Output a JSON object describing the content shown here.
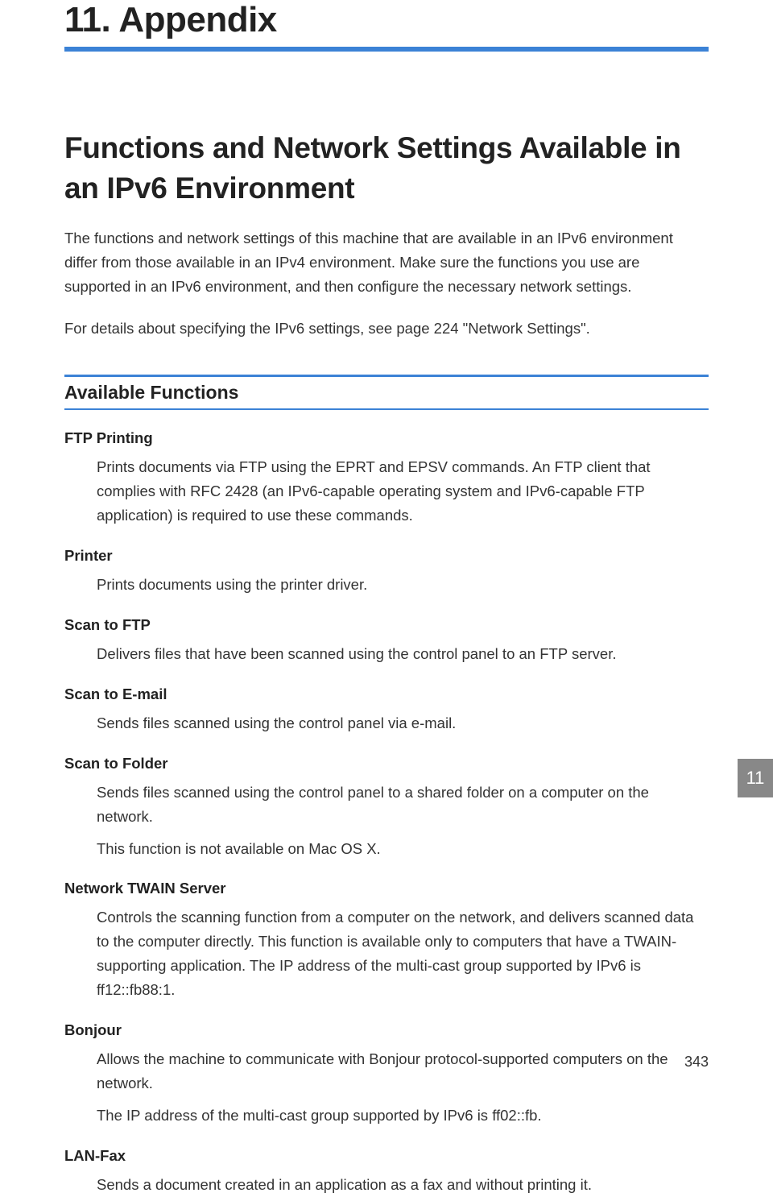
{
  "chapter": {
    "title": "11. Appendix",
    "tab": "11"
  },
  "section": {
    "title": "Functions and Network Settings Available in an IPv6 Environment",
    "intro1": "The functions and network settings of this machine that are available in an IPv6 environment differ from those available in an IPv4 environment. Make sure the functions you use are supported in an IPv6 environment, and then configure the necessary network settings.",
    "intro2": "For details about specifying the IPv6 settings, see page 224 \"Network Settings\"."
  },
  "subsection": {
    "heading": "Available Functions",
    "items": [
      {
        "title": "FTP Printing",
        "desc": [
          "Prints documents via FTP using the EPRT and EPSV commands. An FTP client that complies with RFC 2428 (an IPv6-capable operating system and IPv6-capable FTP application) is required to use these commands."
        ]
      },
      {
        "title": "Printer",
        "desc": [
          "Prints documents using the printer driver."
        ]
      },
      {
        "title": "Scan to FTP",
        "desc": [
          "Delivers files that have been scanned using the control panel to an FTP server."
        ]
      },
      {
        "title": "Scan to E-mail",
        "desc": [
          "Sends files scanned using the control panel via e-mail."
        ]
      },
      {
        "title": "Scan to Folder",
        "desc": [
          "Sends files scanned using the control panel to a shared folder on a computer on the network.",
          "This function is not available on Mac OS X."
        ]
      },
      {
        "title": "Network TWAIN Server",
        "desc": [
          "Controls the scanning function from a computer on the network, and delivers scanned data to the computer directly. This function is available only to computers that have a TWAIN-supporting application. The IP address of the multi-cast group supported by IPv6 is ff12::fb88:1."
        ]
      },
      {
        "title": "Bonjour",
        "desc": [
          "Allows the machine to communicate with Bonjour protocol-supported computers on the network.",
          "The IP address of the multi-cast group supported by IPv6 is ff02::fb."
        ]
      },
      {
        "title": "LAN-Fax",
        "desc": [
          "Sends a document created in an application as a fax and without printing it."
        ]
      }
    ]
  },
  "pageNumber": "343"
}
